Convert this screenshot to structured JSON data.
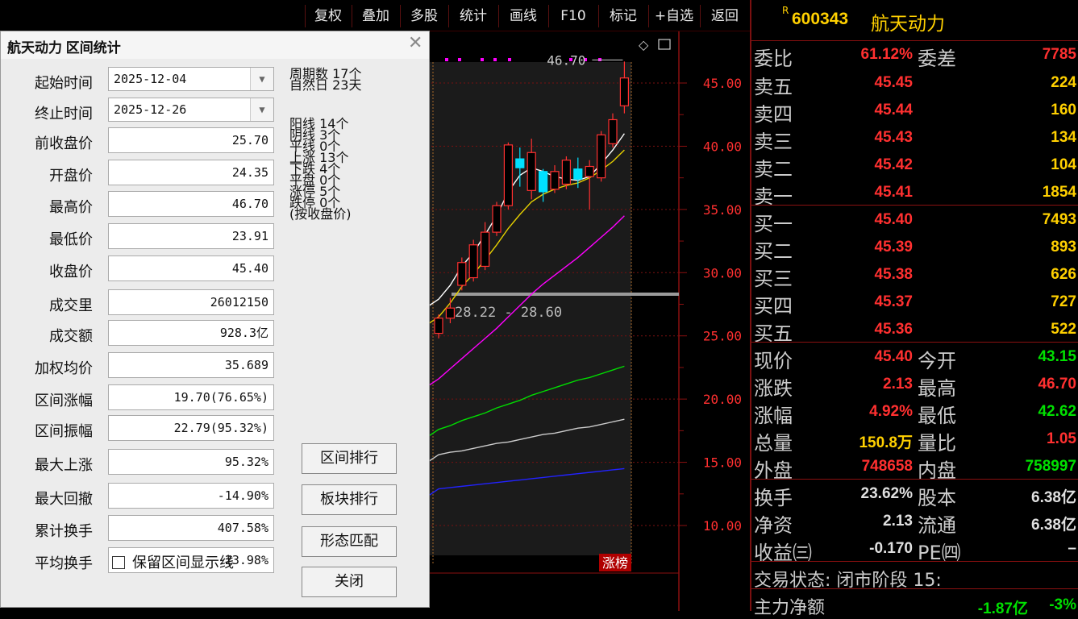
{
  "toolbar": {
    "items": [
      "复权",
      "叠加",
      "多股",
      "统计",
      "画线",
      "F10",
      "标记",
      "+自选",
      "返回"
    ]
  },
  "dialog": {
    "title": "航天动力 区间统计",
    "fields": [
      {
        "label": "起始时间",
        "value": "2025-12-04",
        "type": "combo"
      },
      {
        "label": "终止时间",
        "value": "2025-12-26",
        "type": "combo"
      },
      {
        "label": "前收盘价",
        "value": "25.70"
      },
      {
        "label": "开盘价",
        "value": "24.35"
      },
      {
        "label": "最高价",
        "value": "46.70"
      },
      {
        "label": "最低价",
        "value": "23.91"
      },
      {
        "label": "收盘价",
        "value": "45.40"
      },
      {
        "label": "成交里",
        "value": "26012150"
      },
      {
        "label": "成交额",
        "value": "928.3亿"
      },
      {
        "label": "加权均价",
        "value": "35.689"
      },
      {
        "label": "区间涨幅",
        "value": "19.70(76.65%)"
      },
      {
        "label": "区间振幅",
        "value": "22.79(95.32%)"
      },
      {
        "label": "最大上涨",
        "value": "95.32%"
      },
      {
        "label": "最大回撤",
        "value": "-14.90%"
      },
      {
        "label": "累计换手",
        "value": "407.58%"
      },
      {
        "label": "平均换手",
        "value": "23.98%"
      }
    ],
    "stats": [
      "周期数 17个",
      "自然日 23天",
      "阳线 14个",
      "阴线 3个",
      "平线 0个",
      "上涨 13个",
      "下跌 4个",
      "平盘 0个",
      "涨停 5个",
      "跌停 0个",
      "(按收盘价)"
    ],
    "buttons": {
      "rank": "区间排行",
      "sector": "板块排行",
      "pattern": "形态匹配",
      "close": "关闭"
    },
    "keep_lines": "保留区间显示线"
  },
  "chart": {
    "high_label": "46.70",
    "range_label": "28.22 - 28.60",
    "limit_tag": "涨榜",
    "y_ticks": [
      "45.00",
      "40.00",
      "35.00",
      "30.00",
      "25.00",
      "20.00",
      "15.00",
      "10.00"
    ]
  },
  "chart_data": {
    "type": "candlestick",
    "y_ticks": [
      45,
      40,
      35,
      30,
      25,
      20,
      15,
      10
    ],
    "candles": [
      {
        "o": 25.2,
        "c": 26.4,
        "h": 26.7,
        "l": 24.8
      },
      {
        "o": 26.4,
        "c": 27.2,
        "h": 28.0,
        "l": 26.0
      },
      {
        "o": 29.0,
        "c": 30.8,
        "h": 31.2,
        "l": 28.6
      },
      {
        "o": 29.6,
        "c": 32.2,
        "h": 32.6,
        "l": 29.3
      },
      {
        "o": 30.5,
        "c": 33.2,
        "h": 34.0,
        "l": 30.2
      },
      {
        "o": 33.2,
        "c": 35.3,
        "h": 35.6,
        "l": 32.9
      },
      {
        "o": 35.3,
        "c": 40.1,
        "h": 40.3,
        "l": 35.0
      },
      {
        "o": 39.0,
        "c": 38.3,
        "h": 39.9,
        "l": 36.8
      },
      {
        "o": 36.5,
        "c": 39.5,
        "h": 40.6,
        "l": 35.8
      },
      {
        "o": 38.0,
        "c": 36.4,
        "h": 38.2,
        "l": 35.6
      },
      {
        "o": 36.6,
        "c": 38.0,
        "h": 38.5,
        "l": 36.3
      },
      {
        "o": 37.0,
        "c": 38.9,
        "h": 39.2,
        "l": 36.6
      },
      {
        "o": 38.2,
        "c": 37.4,
        "h": 39.1,
        "l": 36.7
      },
      {
        "o": 37.6,
        "c": 38.4,
        "h": 38.9,
        "l": 35.0
      },
      {
        "o": 37.5,
        "c": 40.9,
        "h": 41.2,
        "l": 37.2
      },
      {
        "o": 40.2,
        "c": 42.1,
        "h": 42.6,
        "l": 39.9
      },
      {
        "o": 43.2,
        "c": 45.4,
        "h": 46.7,
        "l": 42.6
      }
    ],
    "ma_white": [
      27.9,
      29.0,
      30.5,
      31.6,
      33.0,
      34.5,
      36.4,
      37.7,
      38.3,
      38.0,
      37.6,
      37.4,
      37.3,
      37.6,
      38.6,
      39.7,
      41.0
    ],
    "ma_yellow": [
      26.5,
      27.6,
      28.9,
      29.9,
      31.0,
      32.2,
      33.5,
      34.6,
      35.6,
      36.2,
      36.6,
      36.9,
      37.1,
      37.5,
      38.1,
      38.8,
      39.7
    ],
    "ma_magenta": [
      21.6,
      22.4,
      23.2,
      24.0,
      24.8,
      25.6,
      26.5,
      27.4,
      28.3,
      29.1,
      29.8,
      30.5,
      31.2,
      32.0,
      32.8,
      33.6,
      34.5
    ],
    "ma_green": [
      17.6,
      17.9,
      18.3,
      18.6,
      18.9,
      19.3,
      19.6,
      19.9,
      20.3,
      20.6,
      20.9,
      21.2,
      21.5,
      21.7,
      22.0,
      22.3,
      22.6
    ],
    "ma_gray": [
      15.6,
      15.8,
      15.9,
      16.1,
      16.3,
      16.5,
      16.6,
      16.8,
      17.0,
      17.2,
      17.3,
      17.5,
      17.7,
      17.8,
      18.0,
      18.2,
      18.4
    ],
    "ma_blue": [
      12.9,
      13.0,
      13.1,
      13.2,
      13.3,
      13.4,
      13.5,
      13.6,
      13.7,
      13.8,
      13.9,
      14.0,
      14.1,
      14.2,
      14.3,
      14.4,
      14.5
    ]
  },
  "quote": {
    "prefix": "R",
    "code": "600343",
    "name": "航天动力",
    "weibi_label": "委比",
    "weibi": "61.12%",
    "weicha_label": "委差",
    "weicha": "7785",
    "asks": [
      {
        "label": "卖五",
        "price": "45.45",
        "vol": "224"
      },
      {
        "label": "卖四",
        "price": "45.44",
        "vol": "160"
      },
      {
        "label": "卖三",
        "price": "45.43",
        "vol": "134"
      },
      {
        "label": "卖二",
        "price": "45.42",
        "vol": "104"
      },
      {
        "label": "卖一",
        "price": "45.41",
        "vol": "1854"
      }
    ],
    "bids": [
      {
        "label": "买一",
        "price": "45.40",
        "vol": "7493"
      },
      {
        "label": "买二",
        "price": "45.39",
        "vol": "893"
      },
      {
        "label": "买三",
        "price": "45.38",
        "vol": "626"
      },
      {
        "label": "买四",
        "price": "45.37",
        "vol": "727"
      },
      {
        "label": "买五",
        "price": "45.36",
        "vol": "522"
      }
    ],
    "info": [
      {
        "k": "现价",
        "v": "45.40",
        "vc": "#ff3030",
        "k2": "今开",
        "v2": "43.15",
        "v2c": "#00e000"
      },
      {
        "k": "涨跌",
        "v": "2.13",
        "vc": "#ff3030",
        "k2": "最高",
        "v2": "46.70",
        "v2c": "#ff3030"
      },
      {
        "k": "涨幅",
        "v": "4.92%",
        "vc": "#ff3030",
        "k2": "最低",
        "v2": "42.62",
        "v2c": "#00e000"
      },
      {
        "k": "总量",
        "v": "150.8万",
        "vc": "#ffd000",
        "k2": "量比",
        "v2": "1.05",
        "v2c": "#ff3030"
      },
      {
        "k": "外盘",
        "v": "748658",
        "vc": "#ff3030",
        "k2": "内盘",
        "v2": "758997",
        "v2c": "#00e000"
      }
    ],
    "info2": [
      {
        "k": "换手",
        "v": "23.62%",
        "vc": "#e0e0e0",
        "k2": "股本",
        "v2": "6.38亿",
        "v2c": "#e0e0e0"
      },
      {
        "k": "净资",
        "v": "2.13",
        "vc": "#e0e0e0",
        "k2": "流通",
        "v2": "6.38亿",
        "v2c": "#e0e0e0"
      },
      {
        "k": "收益㈢",
        "v": "-0.170",
        "vc": "#e0e0e0",
        "k2": "PE㈣",
        "v2": "–",
        "v2c": "#e0e0e0"
      }
    ],
    "status": "交易状态: 闭市阶段 15:",
    "flow_label": "主力净额",
    "flow_value": "-1.87亿",
    "flow_pct": "-3%"
  },
  "colors": {
    "up": "#ff3030",
    "down": "#00e0ff",
    "grid": "#7a1010"
  }
}
